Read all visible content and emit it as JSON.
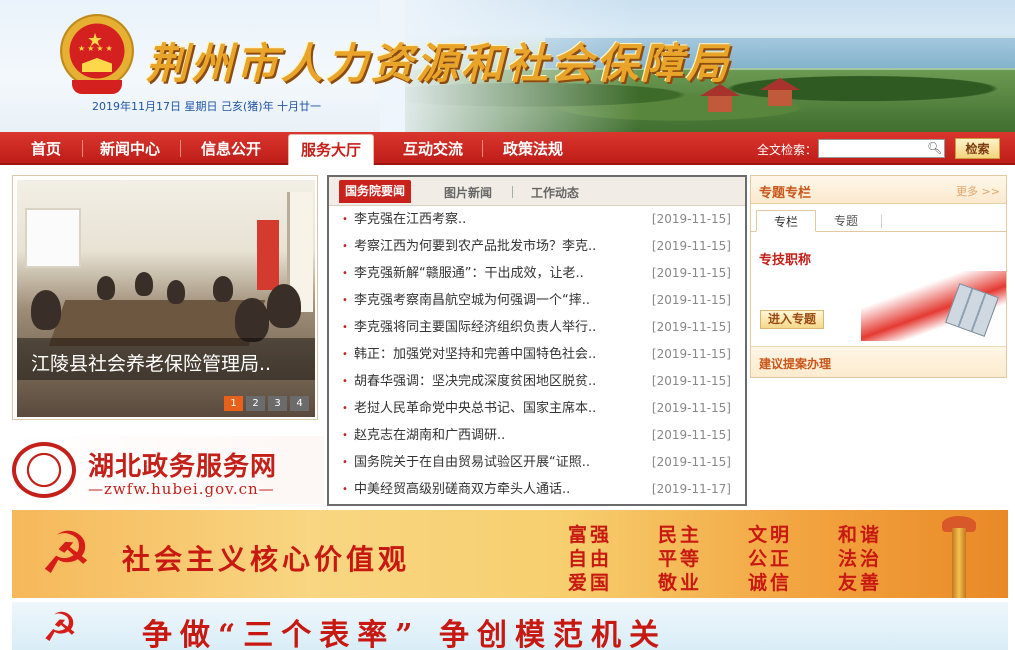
{
  "header": {
    "site_title": "荆州市人力资源和社会保障局",
    "date_line": "2019年11月17日 星期日 己亥(猪)年 十月廿一"
  },
  "nav": {
    "items": [
      {
        "label": "首页"
      },
      {
        "label": "新闻中心"
      },
      {
        "label": "信息公开"
      },
      {
        "label": "服务大厅",
        "active": true
      },
      {
        "label": "互动交流"
      },
      {
        "label": "政策法规"
      }
    ],
    "search_label": "全文检索：",
    "search_value": "",
    "search_button": "检索"
  },
  "slideshow": {
    "caption": "江陵县社会养老保险管理局..",
    "pages": [
      "1",
      "2",
      "3",
      "4"
    ],
    "active_page": 1
  },
  "hubei_banner": {
    "name": "湖北政务服务网",
    "url": "—zwfw.hubei.gov.cn—"
  },
  "news": {
    "tabs": [
      "国务院要闻",
      "图片新闻",
      "工作动态"
    ],
    "active_tab": 0,
    "items": [
      {
        "title": "李克强在江西考察..",
        "date": "[2019-11-15]"
      },
      {
        "title": "考察江西为何要到农产品批发市场？李克..",
        "date": "[2019-11-15]"
      },
      {
        "title": "李克强新解“赣服通”：干出成效，让老..",
        "date": "[2019-11-15]"
      },
      {
        "title": "李克强考察南昌航空城为何强调一个“摔..",
        "date": "[2019-11-15]"
      },
      {
        "title": "李克强将同主要国际经济组织负责人举行..",
        "date": "[2019-11-15]"
      },
      {
        "title": "韩正：加强党对坚持和完善中国特色社会..",
        "date": "[2019-11-15]"
      },
      {
        "title": "胡春华强调：坚决完成深度贫困地区脱贫..",
        "date": "[2019-11-15]"
      },
      {
        "title": "老挝人民革命党中央总书记、国家主席本..",
        "date": "[2019-11-15]"
      },
      {
        "title": "赵克志在湖南和广西调研..",
        "date": "[2019-11-15]"
      },
      {
        "title": "国务院关于在自由贸易试验区开展“证照..",
        "date": "[2019-11-15]"
      },
      {
        "title": "中美经贸高级别磋商双方牵头人通话..",
        "date": "[2019-11-17]"
      }
    ]
  },
  "topic": {
    "title": "专题专栏",
    "more": "更多 >>",
    "subtabs": [
      "专栏",
      "专题"
    ],
    "active_subtab": 0,
    "item": "专技职称",
    "enter_button": "进入专题",
    "footer_link": "建议提案办理"
  },
  "values_banner": {
    "slogan": "社会主义核心价值观",
    "values": [
      "富强",
      "民主",
      "文明",
      "和谐",
      "自由",
      "平等",
      "公正",
      "法治",
      "爱国",
      "敬业",
      "诚信",
      "友善"
    ]
  },
  "model_banner": {
    "text": "争做“三个表率” 争创模范机关"
  },
  "colors": {
    "nav_red": "#c4201a",
    "accent_orange": "#e8611a"
  }
}
